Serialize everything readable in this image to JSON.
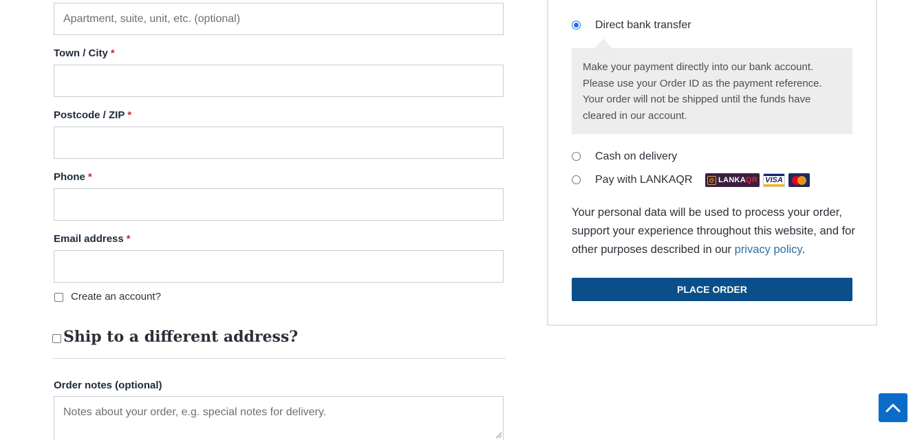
{
  "billing": {
    "address2": {
      "placeholder": "Apartment, suite, unit, etc. (optional)",
      "value": ""
    },
    "city": {
      "label": "Town / City",
      "required_mark": "*",
      "value": ""
    },
    "postcode": {
      "label": "Postcode / ZIP",
      "required_mark": "*",
      "value": ""
    },
    "phone": {
      "label": "Phone",
      "required_mark": "*",
      "value": ""
    },
    "email": {
      "label": "Email address",
      "required_mark": "*",
      "value": ""
    },
    "create_account": {
      "label": "Create an account?",
      "checked": false
    }
  },
  "shipping": {
    "ship_different": {
      "label": "Ship to a different address?",
      "checked": false
    }
  },
  "order_notes": {
    "label": "Order notes (optional)",
    "placeholder": "Notes about your order, e.g. special notes for delivery.",
    "value": ""
  },
  "payment": {
    "methods": [
      {
        "label": "Direct bank transfer",
        "selected": true
      },
      {
        "label": "Cash on delivery",
        "selected": false
      },
      {
        "label": "Pay with LANKAQR",
        "selected": false
      }
    ],
    "bank_description": "Make your payment directly into our bank account. Please use your Order ID as the payment reference. Your order will not be shipped until the funds have cleared in our account.",
    "logos": {
      "lankaqr_prefix": "LANKA",
      "lankaqr_suffix": "QR",
      "visa": "VISA",
      "mastercard_icon": "mastercard-logo"
    },
    "privacy_prefix": "Your personal data will be used to process your order, support your experience throughout this website, and for other purposes described in our ",
    "privacy_link": "privacy policy",
    "privacy_suffix": ".",
    "place_order": "PLACE ORDER"
  },
  "colors": {
    "primary_button": "#0b4f8a",
    "scroll_top": "#0b6bc9",
    "required": "#d4252b",
    "link": "#2d6ea8"
  },
  "icons": {
    "scroll_top": "chevron-up-icon"
  }
}
